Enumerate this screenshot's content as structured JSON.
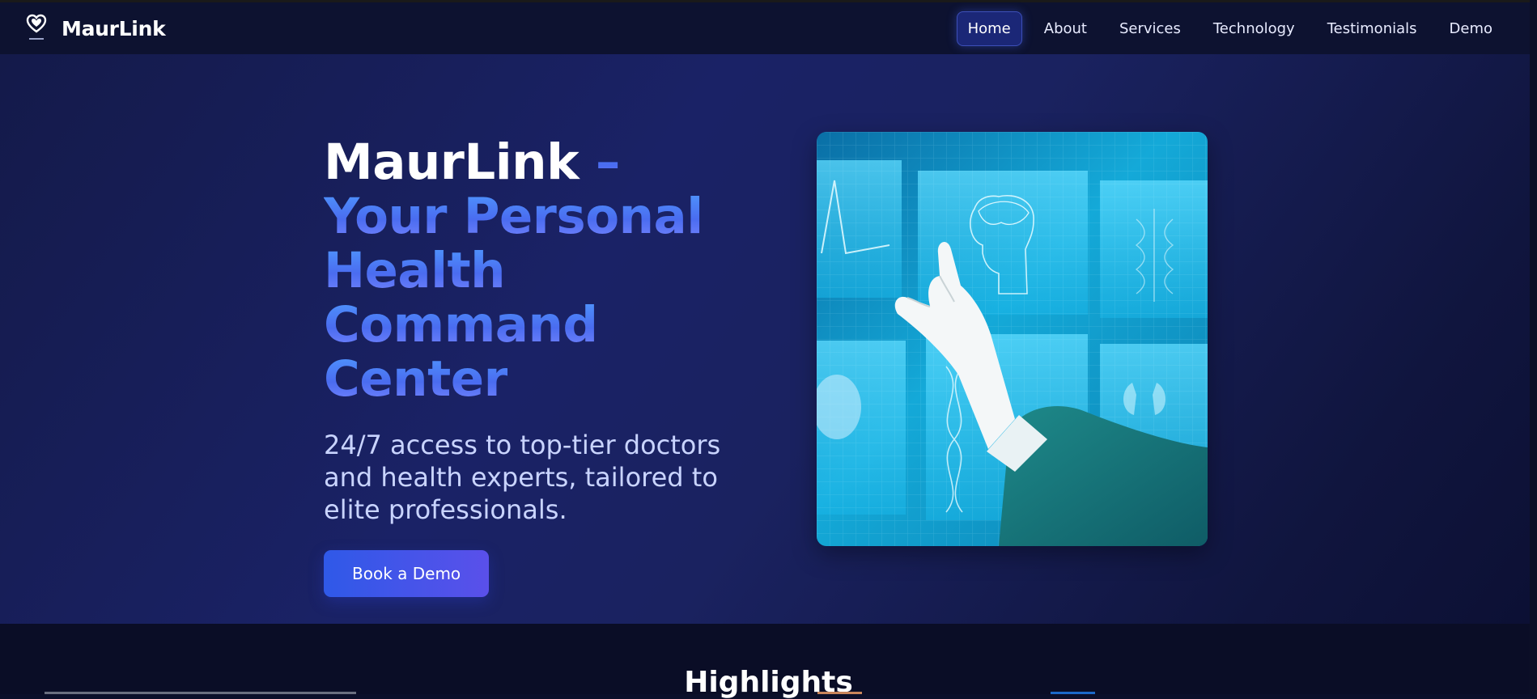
{
  "brand": {
    "name": "MaurLink",
    "logo_icon": "heart-shield-logo-icon"
  },
  "nav": {
    "items": [
      {
        "label": "Home",
        "active": true
      },
      {
        "label": "About",
        "active": false
      },
      {
        "label": "Services",
        "active": false
      },
      {
        "label": "Technology",
        "active": false
      },
      {
        "label": "Testimonials",
        "active": false
      },
      {
        "label": "Demo",
        "active": false
      }
    ]
  },
  "hero": {
    "title_main": "MaurLink",
    "title_accent": " – Your Personal Health Command Center",
    "subtitle": "24/7 access to top-tier doctors and health experts, tailored to elite professionals.",
    "cta_label": "Book a Demo",
    "image_icon": "doctor-touching-holographic-medical-screens-image"
  },
  "section": {
    "title": "Highlights"
  },
  "colors": {
    "nav_bg": "#0d1230",
    "hero_bg": "#1a2266",
    "accent_blue": "#4f9bff",
    "accent_indigo": "#5a50ea",
    "active_nav_bg": "#1b2777"
  }
}
